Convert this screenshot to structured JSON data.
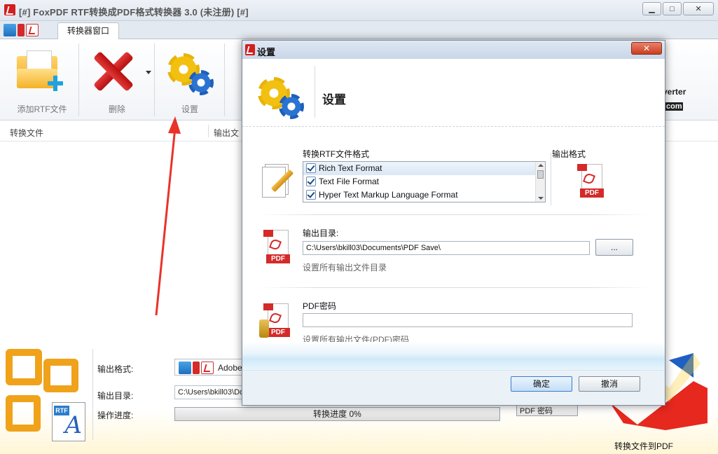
{
  "window": {
    "title": "[#] FoxPDF RTF转换成PDF格式转换器 3.0 (未注册) [#]",
    "min_glyph": "▁",
    "max_glyph": "□",
    "close_glyph": "✕"
  },
  "tabs": {
    "active": "转换器窗口"
  },
  "toolbar": {
    "add_label": "添加RTF文件",
    "delete_label": "删除",
    "settings_label": "设置"
  },
  "file_list": {
    "col_file": "转换文件",
    "col_output": "输出文"
  },
  "bottom": {
    "format_label": "输出格式:",
    "format_value": "Adobe",
    "dir_label": "输出目录:",
    "dir_value": "C:\\Users\\bkill03\\Do",
    "progress_label": "操作进度:",
    "progress_text": "转换进度 0%",
    "progress_value": 0,
    "pdf_password_button": "PDF 密码",
    "convert_label": "转换文件到PDF",
    "brand_text": "verter",
    "brand_text2": "com",
    "rtf_tag": "RTF",
    "rtf_letter": "A"
  },
  "dialog": {
    "title": "设置",
    "heading": "设置",
    "close_glyph": "✕",
    "format_section_label": "转换RTF文件格式",
    "formats": [
      {
        "label": "Rich Text Format",
        "checked": true
      },
      {
        "label": "Text File Format",
        "checked": true
      },
      {
        "label": "Hyper Text Markup Language Format",
        "checked": true
      }
    ],
    "output_format_label": "输出格式",
    "output_dir_label": "输出目录:",
    "output_dir_value": "C:\\Users\\bkill03\\Documents\\PDF Save\\",
    "browse_label": "...",
    "output_dir_hint": "设置所有输出文件目录",
    "pdf_password_label": "PDF密码",
    "pdf_password_value": "",
    "pdf_password_hint": "设置所有输出文件(PDF)密码",
    "ok_label": "确定",
    "cancel_label": "撤消",
    "pdf_badge": "PDF"
  },
  "colors": {
    "accent_red": "#d21f1f",
    "annotation_arrow": "#e8332a"
  }
}
